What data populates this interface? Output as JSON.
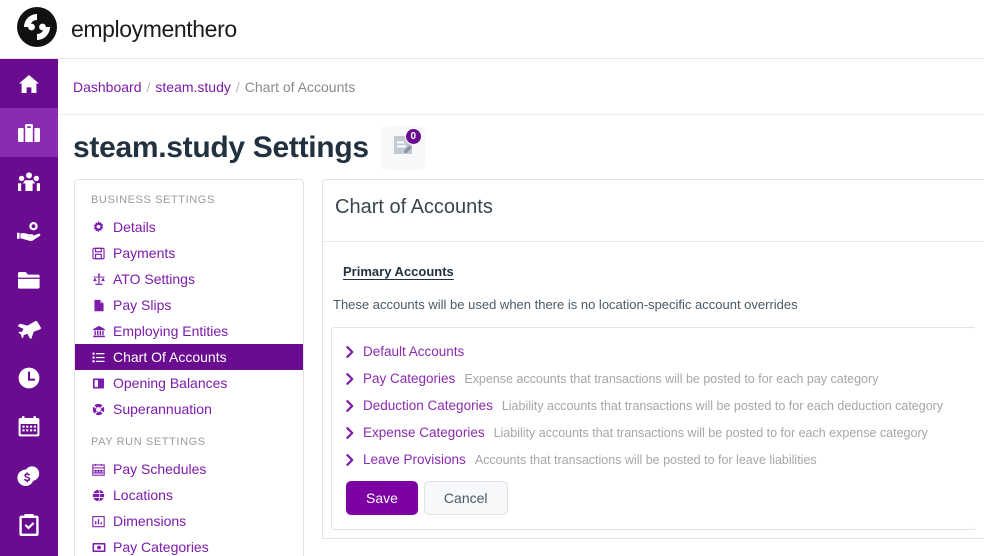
{
  "brand": {
    "name_part1": "employment",
    "name_part2": "hero",
    "logo_icon": "eh-circle-logo"
  },
  "rail": {
    "items": [
      {
        "name": "home",
        "icon": "home-icon",
        "active": false
      },
      {
        "name": "business",
        "icon": "briefcase-icon",
        "active": true
      },
      {
        "name": "people",
        "icon": "users-group-icon",
        "active": false
      },
      {
        "name": "benefits",
        "icon": "hand-holding-money-icon",
        "active": false
      },
      {
        "name": "documents",
        "icon": "folder-icon",
        "active": false
      },
      {
        "name": "leave",
        "icon": "plane-icon",
        "active": false
      },
      {
        "name": "timesheets",
        "icon": "clock-icon",
        "active": false
      },
      {
        "name": "calendar",
        "icon": "calendar-icon",
        "active": false
      },
      {
        "name": "pay",
        "icon": "coins-icon",
        "active": false
      },
      {
        "name": "tasks",
        "icon": "clipboard-check-icon",
        "active": false
      }
    ]
  },
  "breadcrumb": {
    "items": [
      {
        "label": "Dashboard",
        "link": true
      },
      {
        "label": "steam.study",
        "link": true
      },
      {
        "label": "Chart of Accounts",
        "link": false
      }
    ],
    "separator": "/"
  },
  "page": {
    "title": "steam.study Settings",
    "note_badge_count": "0",
    "note_badge_icon": "note-document-icon"
  },
  "settings_nav": {
    "groups": [
      {
        "title": "BUSINESS SETTINGS",
        "items": [
          {
            "label": "Details",
            "icon": "gear-icon",
            "active": false
          },
          {
            "label": "Payments",
            "icon": "save-floppy-icon",
            "active": false
          },
          {
            "label": "ATO Settings",
            "icon": "balance-scale-icon",
            "active": false
          },
          {
            "label": "Pay Slips",
            "icon": "file-icon",
            "active": false
          },
          {
            "label": "Employing Entities",
            "icon": "bank-icon",
            "active": false
          },
          {
            "label": "Chart Of Accounts",
            "icon": "list-icon",
            "active": true
          },
          {
            "label": "Opening Balances",
            "icon": "book-icon",
            "active": false
          },
          {
            "label": "Superannuation",
            "icon": "life-ring-icon",
            "active": false
          }
        ]
      },
      {
        "title": "PAY RUN SETTINGS",
        "items": [
          {
            "label": "Pay Schedules",
            "icon": "calendar-icon",
            "active": false
          },
          {
            "label": "Locations",
            "icon": "globe-icon",
            "active": false
          },
          {
            "label": "Dimensions",
            "icon": "chart-bar-icon",
            "active": false
          },
          {
            "label": "Pay Categories",
            "icon": "money-bill-icon",
            "active": false
          }
        ]
      }
    ]
  },
  "main": {
    "heading": "Chart of Accounts",
    "tabs": [
      {
        "label": "Primary Accounts",
        "active": true
      }
    ],
    "description": "These accounts will be used when there is no location-specific account overrides",
    "accordion": [
      {
        "label": "Default Accounts",
        "desc": "",
        "icon": "chevron-right-icon"
      },
      {
        "label": "Pay Categories",
        "desc": "Expense accounts that transactions will be posted to for each pay category",
        "icon": "chevron-right-icon"
      },
      {
        "label": "Deduction Categories",
        "desc": "Liability accounts that transactions will be posted to for each deduction category",
        "icon": "chevron-right-icon"
      },
      {
        "label": "Expense Categories",
        "desc": "Liability accounts that transactions will be posted to for each expense category",
        "icon": "chevron-right-icon"
      },
      {
        "label": "Leave Provisions",
        "desc": "Accounts that transactions will be posted to for leave liabilities",
        "icon": "chevron-right-icon"
      }
    ],
    "buttons": {
      "save": "Save",
      "cancel": "Cancel"
    }
  },
  "colors": {
    "rail_base": "#6a0c90",
    "rail_active": "#8b2bb0",
    "link_purple": "#7d1bab",
    "save_purple": "#7d00a3",
    "title_navy": "#22313f",
    "muted_gray": "#a6a6a6"
  }
}
